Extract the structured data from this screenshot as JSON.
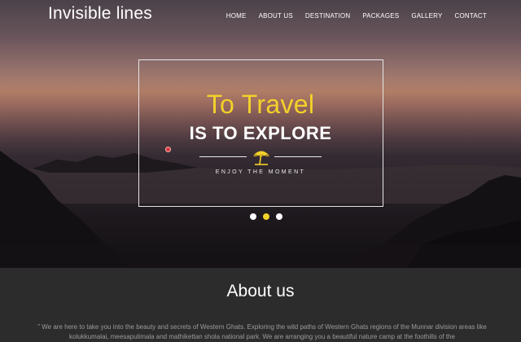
{
  "brand": {
    "logo": "Invisible lines"
  },
  "nav": {
    "items": [
      {
        "label": "HOME"
      },
      {
        "label": "ABOUT US"
      },
      {
        "label": "DESTINATION"
      },
      {
        "label": "PACKAGES"
      },
      {
        "label": "GALLERY"
      },
      {
        "label": "CONTACT"
      }
    ]
  },
  "hero": {
    "title_line1": "To Travel",
    "title_line2": "IS TO EXPLORE",
    "tagline": "ENJOY THE MOMENT",
    "icon": "beach-umbrella-icon",
    "slides": 3,
    "active_slide": 2,
    "colors": {
      "accent": "#f3d12a",
      "frame": "#e6e6e6"
    }
  },
  "about": {
    "title": "About us",
    "text": "\" We are here to take you into the beauty and secrets of Western Ghats. Exploring the wild paths of Western Ghats regions of the Munnar division areas like kolukkumalai, meesapulimala and mathikettan shola national park. We are arranging you a beautiful nature camp at the foothills of the"
  }
}
